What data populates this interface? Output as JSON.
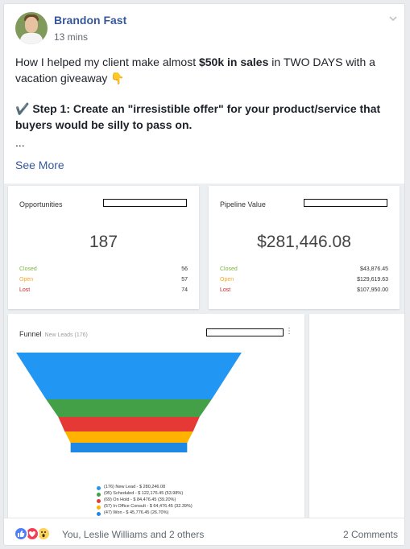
{
  "post": {
    "author": "Brandon Fast",
    "time": "13 mins",
    "line1_pre": "How I helped my client make almost ",
    "line1_bold": "$50k in sales",
    "line1_post": " in TWO DAYS with a vacation giveaway",
    "point_emoji": "👇",
    "check_emoji": "✔️",
    "step1": "Step 1: Create an \"irresistible offer\" for your product/service that buyers would be silly to pass on.",
    "ellipsis": "...",
    "see_more": "See More"
  },
  "opportunities": {
    "title": "Opportunities",
    "count": "187",
    "rows": [
      {
        "label": "Closed",
        "value": "56",
        "color": "#7cb342"
      },
      {
        "label": "Open",
        "value": "57",
        "color": "#f9a825"
      },
      {
        "label": "Lost",
        "value": "74",
        "color": "#c62828"
      }
    ]
  },
  "pipeline": {
    "title": "Pipeline Value",
    "total": "$281,446.08",
    "rows": [
      {
        "label": "Closed",
        "value": "$43,876.45",
        "color": "#7cb342"
      },
      {
        "label": "Open",
        "value": "$129,619.63",
        "color": "#f9a825"
      },
      {
        "label": "Lost",
        "value": "$107,950.00",
        "color": "#c62828"
      }
    ]
  },
  "funnel": {
    "title": "Funnel",
    "subtitle": "New Leads (176)",
    "menu_icon": "⋮",
    "legend": [
      {
        "text": "(176) New Lead - $ 280,246.08",
        "color": "#2196f3"
      },
      {
        "text": "(95) Scheduled - $ 122,176.45 (53.98%)",
        "color": "#43a047"
      },
      {
        "text": "(69) On Hold - $ 84,476.45 (39.20%)",
        "color": "#e53935"
      },
      {
        "text": "(57) In Office Consult - $ 64,476.45 (32.39%)",
        "color": "#ffb300"
      },
      {
        "text": "(47) Won - $ 45,776.45 (26.70%)",
        "color": "#1e88e5"
      }
    ]
  },
  "chart_data": {
    "type": "funnel",
    "title": "Funnel",
    "categories": [
      "New Lead",
      "Scheduled",
      "On Hold",
      "In Office Consult",
      "Won"
    ],
    "counts": [
      176,
      95,
      69,
      57,
      47
    ],
    "values": [
      280246.08,
      122176.45,
      84476.45,
      64476.45,
      45776.45
    ],
    "percentages": [
      null,
      53.98,
      39.2,
      32.39,
      26.7
    ],
    "colors": [
      "#2196f3",
      "#43a047",
      "#e53935",
      "#ffb300",
      "#1e88e5"
    ]
  },
  "footer": {
    "reactions": [
      "like-icon",
      "love-icon",
      "wow-icon"
    ],
    "names": "You, Leslie Williams and 2 others",
    "comments": "2 Comments"
  }
}
